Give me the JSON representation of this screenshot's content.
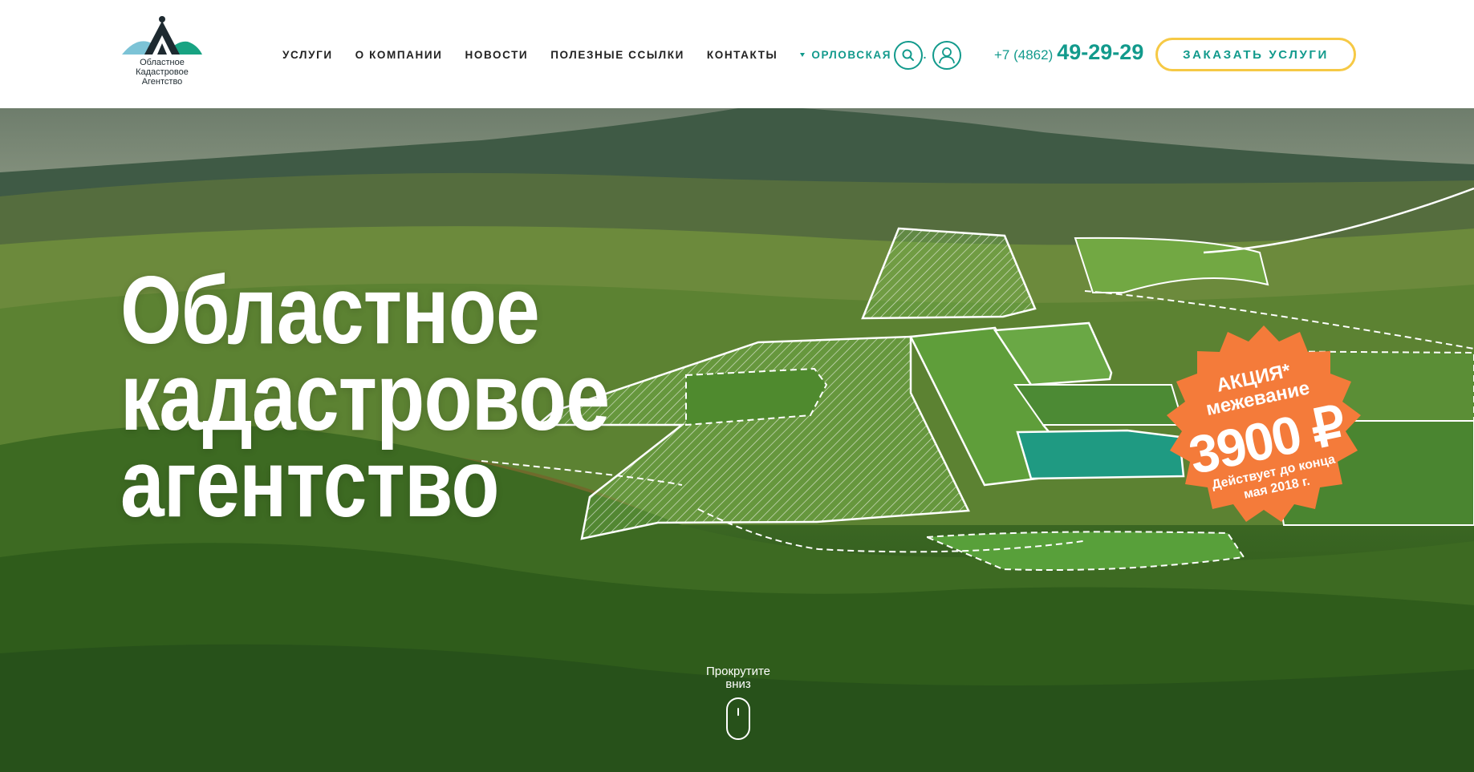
{
  "header": {
    "logo": {
      "line1": "Областное",
      "line2": "Кадастровое",
      "line3": "Агентство"
    },
    "nav": [
      {
        "label": "УСЛУГИ"
      },
      {
        "label": "О КОМПАНИИ"
      },
      {
        "label": "НОВОСТИ"
      },
      {
        "label": "ПОЛЕЗНЫЕ ССЫЛКИ"
      },
      {
        "label": "КОНТАКТЫ"
      }
    ],
    "region": "ОРЛОВСКАЯ ОБЛ.",
    "icons": {
      "search": "search-icon",
      "user": "user-icon"
    },
    "phone": {
      "code": "+7 (4862)",
      "number": "49-29-29"
    },
    "order_button": "ЗАКАЗАТЬ УСЛУГИ"
  },
  "hero": {
    "title": [
      "Областное",
      "кадастровое",
      "агентство"
    ],
    "promo": {
      "line1": "АКЦИЯ*",
      "line2": "межевание",
      "price": "3900 ₽",
      "note1": "Действует до конца",
      "note2": "мая 2018 г."
    },
    "scroll": {
      "line1": "Прокрутите",
      "line2": "вниз"
    }
  },
  "colors": {
    "accent": "#129a8c",
    "button_border": "#f6c945",
    "promo": "#f47b3a",
    "highlight_plot": "#1f9a82"
  }
}
